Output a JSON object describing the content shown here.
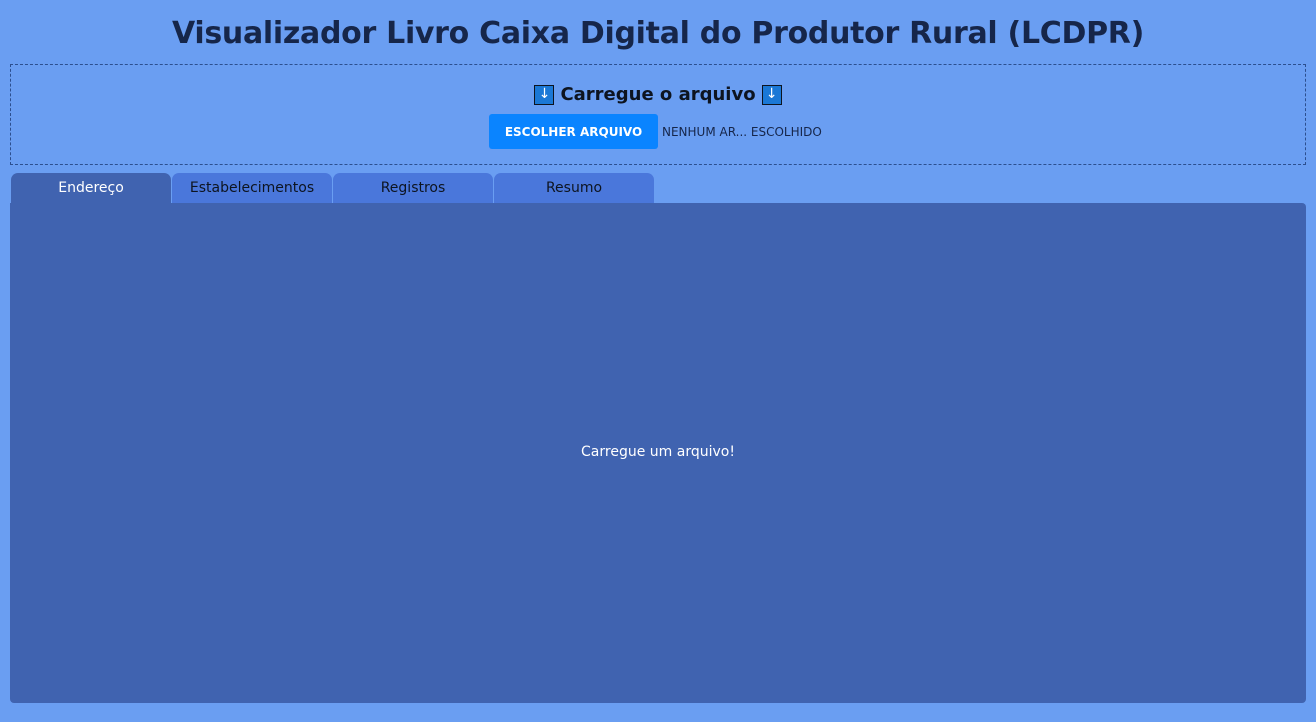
{
  "header": {
    "title": "Visualizador Livro Caixa Digital do Produtor Rural (LCDPR)"
  },
  "upload": {
    "heading": "Carregue o arquivo",
    "icon_left": "arrow-down-icon",
    "icon_right": "arrow-down-icon",
    "icon_glyph": "↓",
    "button_label": "ESCOLHER ARQUIVO",
    "file_status": "NENHUM AR... ESCOLHIDO"
  },
  "tabs": [
    {
      "label": "Endereço",
      "active": true
    },
    {
      "label": "Estabelecimentos",
      "active": false
    },
    {
      "label": "Registros",
      "active": false
    },
    {
      "label": "Resumo",
      "active": false
    }
  ],
  "main": {
    "empty_message": "Carregue um arquivo!"
  },
  "colors": {
    "background": "#6a9ef2",
    "panel": "#4063b0",
    "tab_inactive": "#4a77db",
    "button": "#0a84ff",
    "title_text": "#16264a"
  }
}
